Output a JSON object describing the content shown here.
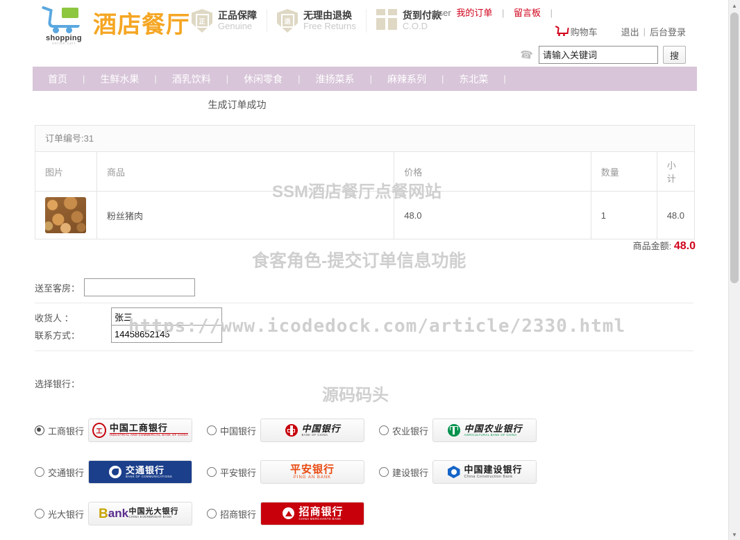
{
  "header": {
    "logo_text": "shopping",
    "logo_subtext": "online cart",
    "site_title": "酒店餐厅",
    "promos": [
      {
        "icon": "shield-genuine-icon",
        "glyph": "正",
        "cn": "正品保障",
        "en": "Genuine"
      },
      {
        "icon": "shield-returns-icon",
        "glyph": "退",
        "cn": "无理由退换",
        "en": "Free Returns"
      },
      {
        "icon": "gift-cod-icon",
        "glyph": "",
        "cn": "货到付款",
        "en": "C.O.D"
      }
    ],
    "user_name": "user",
    "my_orders": "我的订单",
    "message_board": "留言板",
    "cart": "购物车",
    "logout": "退出",
    "admin_login": "后台登录",
    "separator": "|"
  },
  "search": {
    "placeholder": "请输入关键词",
    "value": "",
    "button": "搜",
    "phone_icon": "phone-icon"
  },
  "nav": {
    "items": [
      "首页",
      "生鲜水果",
      "酒乳饮料",
      "休闲零食",
      "淮扬菜系",
      "麻辣系列",
      "东北菜"
    ],
    "separator": "|"
  },
  "order": {
    "status_text": "生成订单成功",
    "order_no_label": "订单编号:31",
    "columns": [
      "图片",
      "商品",
      "价格",
      "数量",
      "小计"
    ],
    "rows": [
      {
        "image": "food-thumbnail",
        "name": "粉丝猪肉",
        "price": "48.0",
        "qty": "1",
        "subtotal": "48.0"
      }
    ],
    "amount_label": "商品金额:",
    "amount_value": "48.0",
    "amount_color": "#d0021b"
  },
  "form": {
    "room_label": "送至客房：",
    "room_value": "",
    "receiver_label": "收货人  ：",
    "receiver_value": "张三",
    "contact_label": "联系方式：",
    "contact_value": "14458652145"
  },
  "bank": {
    "label": "选择银行：",
    "selected": "工商银行",
    "options": [
      {
        "name": "工商银行",
        "logo_cn": "中国工商银行",
        "logo_en": "INDUSTRIAL AND COMMERCIAL BANK OF CHINA",
        "mark": "icbc-mark",
        "cn_color": "#1a1a1a",
        "en_color": "#c7000b",
        "bg": "gradient",
        "selected": true
      },
      {
        "name": "中国银行",
        "logo_cn": "中国银行",
        "logo_en": "BANK OF CHINA",
        "mark": "boc-mark",
        "cn_color": "#1a1a1a",
        "en_color": "#444444",
        "bg": "gradient",
        "selected": false
      },
      {
        "name": "农业银行",
        "logo_cn": "中国农业银行",
        "logo_en": "AGRICULTURAL BANK OF CHINA",
        "mark": "abc-mark",
        "cn_color": "#1a1a1a",
        "en_color": "#00924c",
        "bg": "gradient",
        "selected": false
      },
      {
        "name": "交通银行",
        "logo_cn": "交通银行",
        "logo_en": "BANK OF COMMUNICATIONS",
        "mark": "bocom-mark",
        "cn_color": "#ffffff",
        "en_color": "#ffffff",
        "bg": "#1b3f8b",
        "selected": false
      },
      {
        "name": "平安银行",
        "logo_cn": "平安银行",
        "logo_en": "PING AN BANK",
        "mark": "none",
        "cn_color": "#e8490f",
        "en_color": "#e8490f",
        "bg": "gradient",
        "selected": false
      },
      {
        "name": "建设银行",
        "logo_cn": "中国建设银行",
        "logo_en": "China Construction Bank",
        "mark": "ccb-mark",
        "cn_color": "#1a1a1a",
        "en_color": "#555555",
        "bg": "gradient",
        "selected": false
      },
      {
        "name": "光大银行",
        "logo_cn": "中国光大银行",
        "logo_en": "CHINA EVERBRIGHT BANK",
        "mark": "ceb-mark",
        "cn_color": "#1a1a1a",
        "en_color": "#333333",
        "bg": "gradient",
        "selected": false
      },
      {
        "name": "招商银行",
        "logo_cn": "招商银行",
        "logo_en": "CHINA MERCHANTS BANK",
        "mark": "cmb-mark",
        "cn_color": "#ffffff",
        "en_color": "#ffffff",
        "bg": "#c7000b",
        "selected": false
      }
    ]
  },
  "watermarks": {
    "site": "SSM酒店餐厅点餐网站",
    "feature": "食客角色-提交订单信息功能",
    "url": "https://www.icodedock.com/article/2330.html",
    "brand": "源码码头"
  },
  "scrollbar": {
    "up": "▲",
    "down": "▼"
  }
}
